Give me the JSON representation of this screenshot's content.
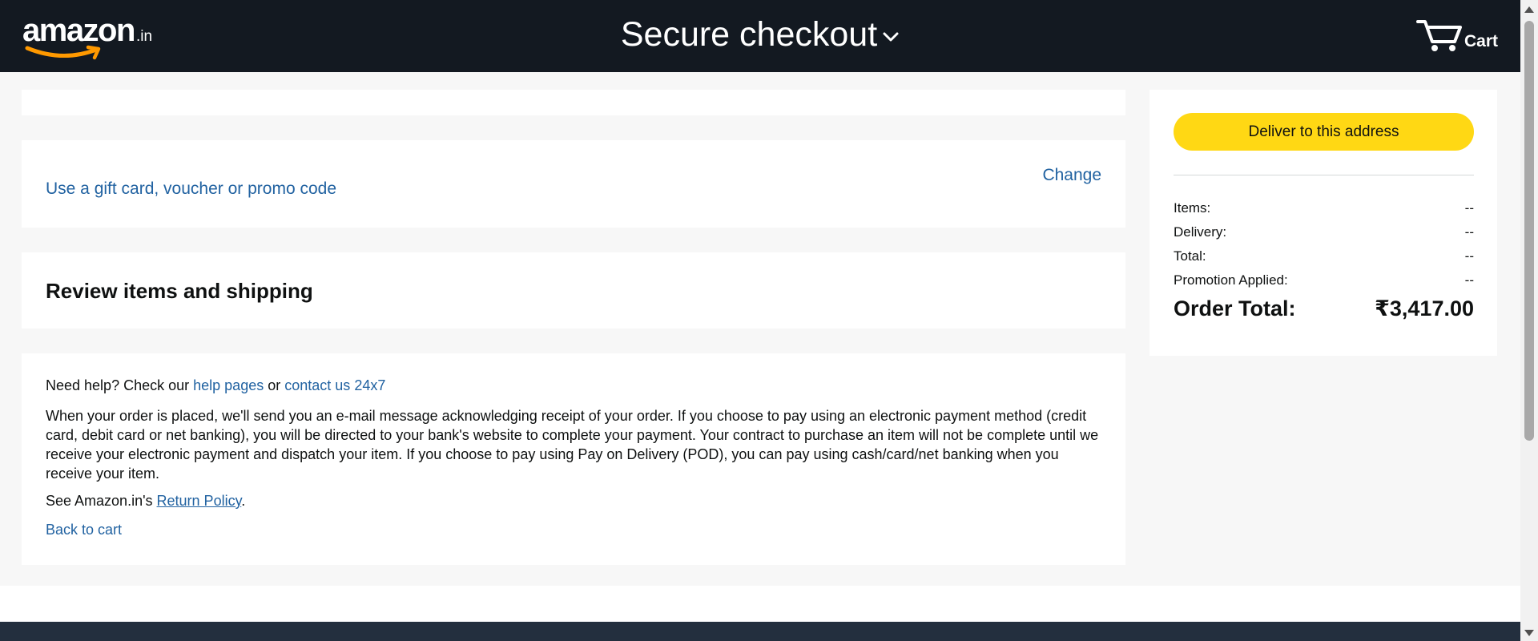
{
  "header": {
    "logo_text": "amazon",
    "logo_tld": ".in",
    "title": "Secure checkout",
    "cart_label": "Cart"
  },
  "gift": {
    "link": "Use a gift card, voucher or promo code",
    "change": "Change"
  },
  "review": {
    "title": "Review items and shipping"
  },
  "help": {
    "prefix": "Need help? Check our",
    "help_pages": "help pages",
    "or": "or",
    "contact": "contact us 24x7",
    "paragraph": "When your order is placed, we'll send you an e-mail message acknowledging receipt of your order. If you choose to pay using an electronic payment method (credit card, debit card or net banking), you will be directed to your bank's website to complete your payment. Your contract to purchase an item will not be complete until we receive your electronic payment and dispatch your item. If you choose to pay using Pay on Delivery (POD), you can pay using cash/card/net banking when you receive your item.",
    "return_prefix": "See Amazon.in's",
    "return_link": "Return Policy",
    "return_suffix": ".",
    "back": "Back to cart"
  },
  "summary": {
    "button": "Deliver to this address",
    "rows": [
      {
        "label": "Items:",
        "value": "--"
      },
      {
        "label": "Delivery:",
        "value": "--"
      },
      {
        "label": "Total:",
        "value": "--"
      },
      {
        "label": "Promotion Applied:",
        "value": "--"
      }
    ],
    "order_total_label": "Order Total:",
    "order_total_value": "₹3,417.00"
  },
  "colors": {
    "header_bg": "#131921",
    "button_yellow": "#ffd814",
    "link_blue": "#2162a1",
    "logo_smile": "#ff9900"
  }
}
